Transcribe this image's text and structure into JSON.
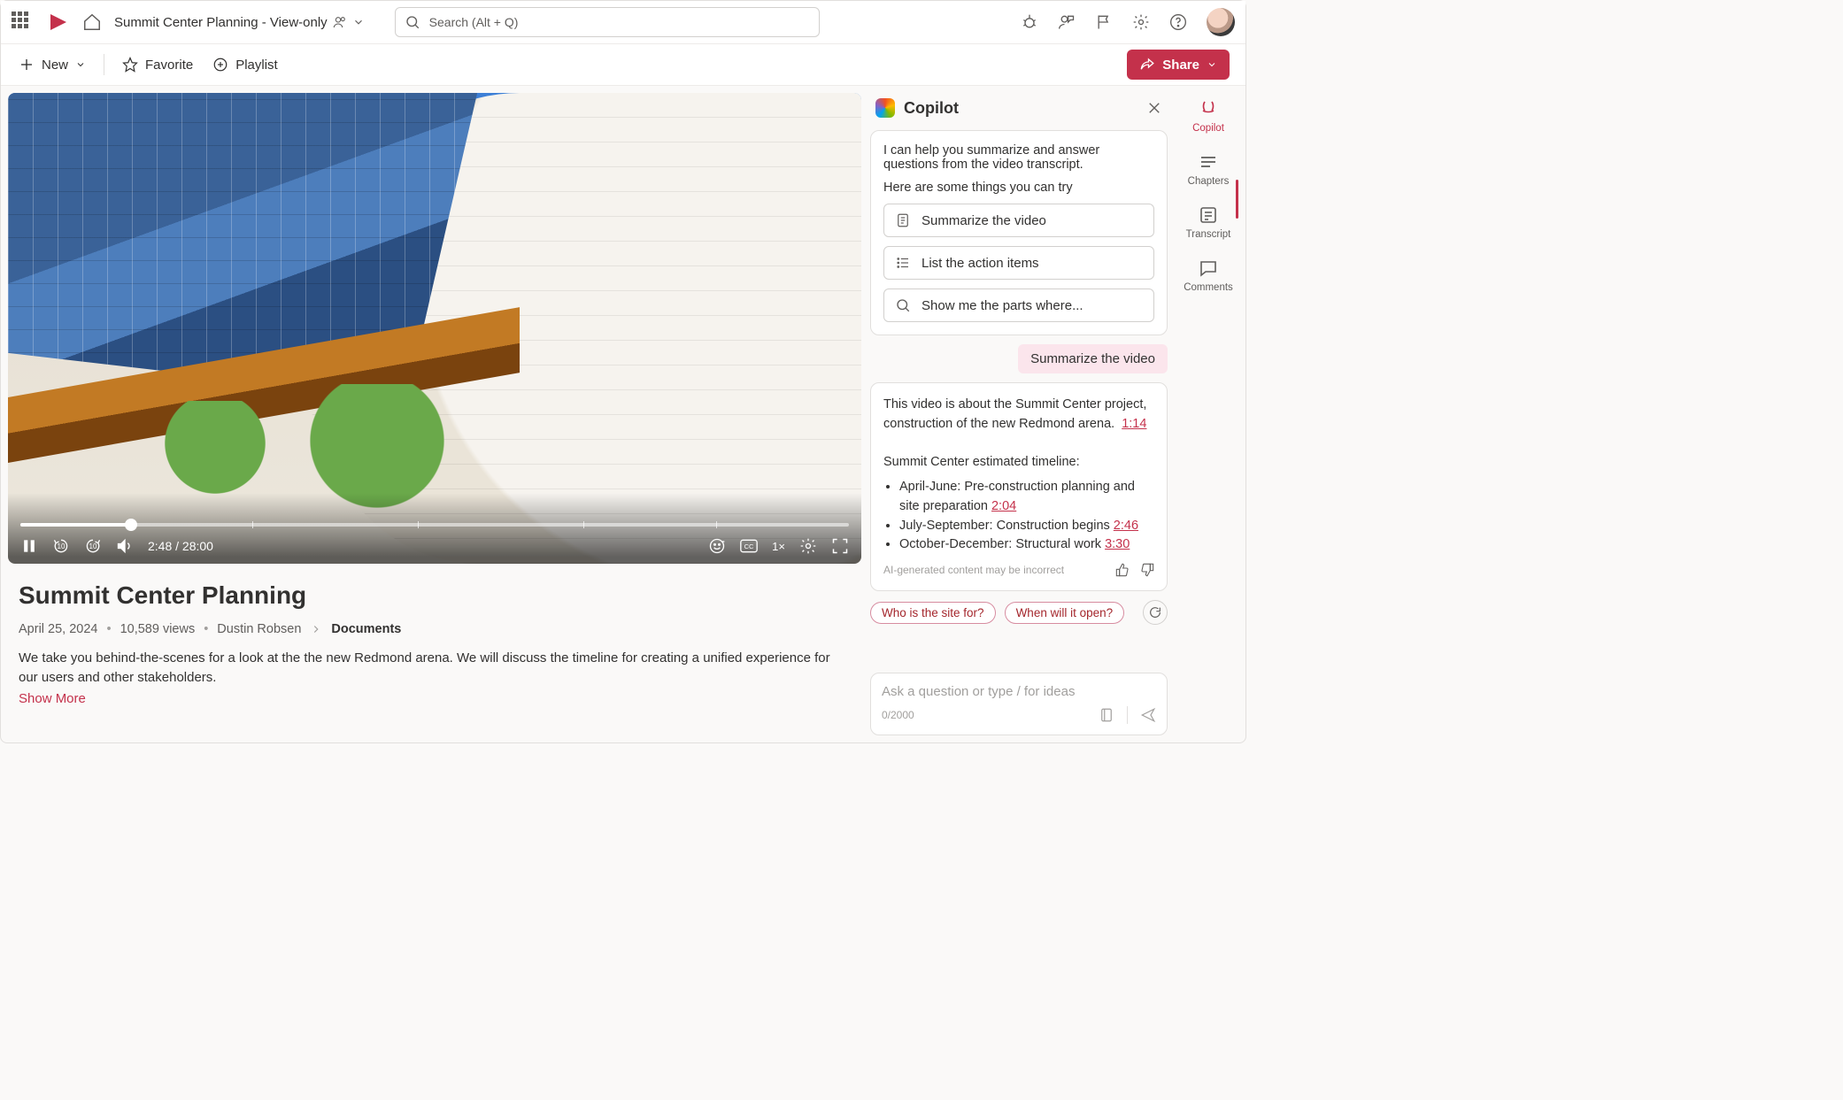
{
  "suite": {
    "doc_title": "Summit Center Planning - View-only",
    "search_placeholder": "Search (Alt + Q)"
  },
  "commands": {
    "new": "New",
    "favorite": "Favorite",
    "playlist": "Playlist",
    "share": "Share"
  },
  "player": {
    "current_time": "2:48",
    "duration": "28:00",
    "time_display": "2:48 / 28:00",
    "rate": "1×"
  },
  "video": {
    "title": "Summit Center Planning",
    "date": "April 25, 2024",
    "views": "10,589 views",
    "author": "Dustin Robsen",
    "location": "Documents",
    "description": "We take you behind-the-scenes for a look at the the new Redmond arena. We will discuss the timeline for creating a unified experience for our users and other stakeholders.",
    "show_more": "Show More"
  },
  "copilot": {
    "title": "Copilot",
    "intro": "I can help you summarize and answer questions from the video transcript.",
    "try_label": "Here are some things you can try",
    "suggestions": {
      "summarize": "Summarize the video",
      "action_items": "List the action items",
      "parts_where": "Show me the parts where..."
    },
    "user_msg": "Summarize the video",
    "response": {
      "lead": "This video is about the Summit Center project, construction of the new Redmond arena.",
      "lead_ts": "1:14",
      "heading": "Summit Center estimated timeline:",
      "items": [
        {
          "text": "April-June: Pre-construction planning and site preparation",
          "ts": "2:04"
        },
        {
          "text": "July-September: Construction begins",
          "ts": "2:46"
        },
        {
          "text": "October-December: Structural work",
          "ts": "3:30"
        }
      ],
      "disclaimer": "AI-generated content may be incorrect"
    },
    "chips": {
      "who": "Who is the site for?",
      "when": "When will it open?"
    },
    "ask_placeholder": "Ask a question or type / for ideas",
    "char_count": "0/2000"
  },
  "rail": {
    "copilot": "Copilot",
    "chapters": "Chapters",
    "transcript": "Transcript",
    "comments": "Comments"
  }
}
